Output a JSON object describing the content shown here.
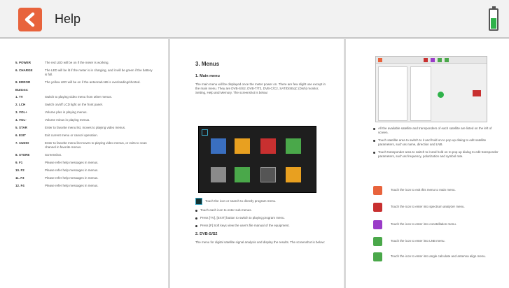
{
  "header": {
    "title": "Help",
    "battery_level": 0.55
  },
  "colors": {
    "accent": "#e8633c",
    "battery": "#2fb24a"
  },
  "page1": {
    "top_rows": [
      {
        "key": "5. POWER",
        "value": "The red LED will be on if the meter is working."
      },
      {
        "key": "6. CHARGE",
        "value": "The LED will be lit if the meter is in charging, and it will be green if the battery is full."
      },
      {
        "key": "8. ERROR",
        "value": "The yellow LED will be on if the antenna/LNB is overloading/shorted."
      }
    ],
    "buttons_title": "Buttons:",
    "button_rows": [
      {
        "key": "1. TV",
        "value": "Switch to playing video menu from other menus."
      },
      {
        "key": "2. LCH",
        "value": "Switch on/off LCD light on the front panel."
      },
      {
        "key": "3. VOL+",
        "value": "Volume plus in playing menus."
      },
      {
        "key": "4. VOL-",
        "value": "Volume minus in playing menus."
      },
      {
        "key": "5. STAR",
        "value": "Enter to favorite menu list, moves to playing video menus."
      },
      {
        "key": "6. EXIT",
        "value": "Exit current menu or cancel operation."
      },
      {
        "key": "7. AUDIO",
        "value": "Enter to favorite menu list moves to playing video menus, or exits to scan channel in favorite menus."
      },
      {
        "key": "8. STORE",
        "value": "Screenshot."
      },
      {
        "key": "9. F1",
        "value": "Please refer help messages in menus."
      },
      {
        "key": "10. F2",
        "value": "Please refer help messages in menus."
      },
      {
        "key": "11. F3",
        "value": "Please refer help messages in menus."
      },
      {
        "key": "12. F4",
        "value": "Please refer help messages in menus."
      }
    ]
  },
  "page2": {
    "heading": "3. Menus",
    "subheading": "1. Main menu",
    "intro": "The main menu will be displayed once the meter power on. There are few slight use except in the main menu. They are DVB-S/S2, DVB-T/T2, DVB-C/C2, SAT/DiSEqC (Dish) monitor, Setting, Help and Memory. The screenshot is below:",
    "touch_note": "Touch the icon or search to directly program menu.",
    "bullets": [
      "Touch each icon to enter sub-menus.",
      "Press [TV], [EXIT] button to switch to playing program menu.",
      "Press [F] Soft keys view the user's file manual of the equipment."
    ],
    "section2": "2. DVB-S/S2",
    "section2_text": "The menu for digital satellite signal analysis and display the results. The screenshot is below:"
  },
  "page3": {
    "bullets": [
      "All the available satellite and transponders of each satellite are listed on the left of screen.",
      "Touch satellite area to switch to it and hold on to pop up dialog to edit satellite parameters, such as name, direction and LNB.",
      "Touch transponder area to switch to it and hold on to pop up dialog to edit transponder parameters, such as frequency, polarization and symbol rate."
    ],
    "icon_rows": [
      {
        "icon": "back-icon",
        "text": "Touch the icon to exit this menu to main menu."
      },
      {
        "icon": "spectrum-icon",
        "text": "Touch the icon to enter into spectrum analyzer menu."
      },
      {
        "icon": "constellation-icon",
        "text": "Touch the icon to enter into constellation menu."
      },
      {
        "icon": "lnb-icon",
        "text": "Touch the icon to enter into LNB menu."
      },
      {
        "icon": "angle-icon",
        "text": "Touch the icon to enter into angle calculate and antenna align menu."
      }
    ]
  }
}
